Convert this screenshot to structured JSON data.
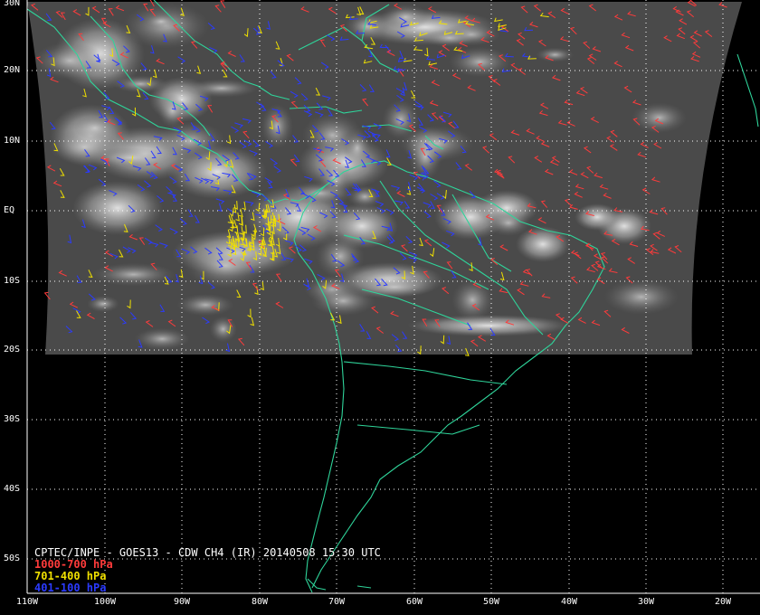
{
  "title": "CPTEC/INPE - GOES13 - CDW CH4 (IR) 20140508 15:30 UTC",
  "legend": [
    {
      "label": "1000-700 hPa",
      "color": "#ff3b3b"
    },
    {
      "label": "701-400 hPa",
      "color": "#f0e000"
    },
    {
      "label": "401-100 hPa",
      "color": "#2b3bff"
    }
  ],
  "lat_labels": [
    "30N",
    "20N",
    "10N",
    "EQ",
    "10S",
    "20S",
    "30S",
    "40S",
    "50S"
  ],
  "lon_labels": [
    "110W",
    "100W",
    "90W",
    "80W",
    "70W",
    "60W",
    "50W",
    "40W",
    "30W",
    "20W"
  ],
  "colors": {
    "coastline": "#2fd49a",
    "grid": "#ffffff",
    "satellite_cloud": "#bdbdbd",
    "background": "#000000"
  }
}
